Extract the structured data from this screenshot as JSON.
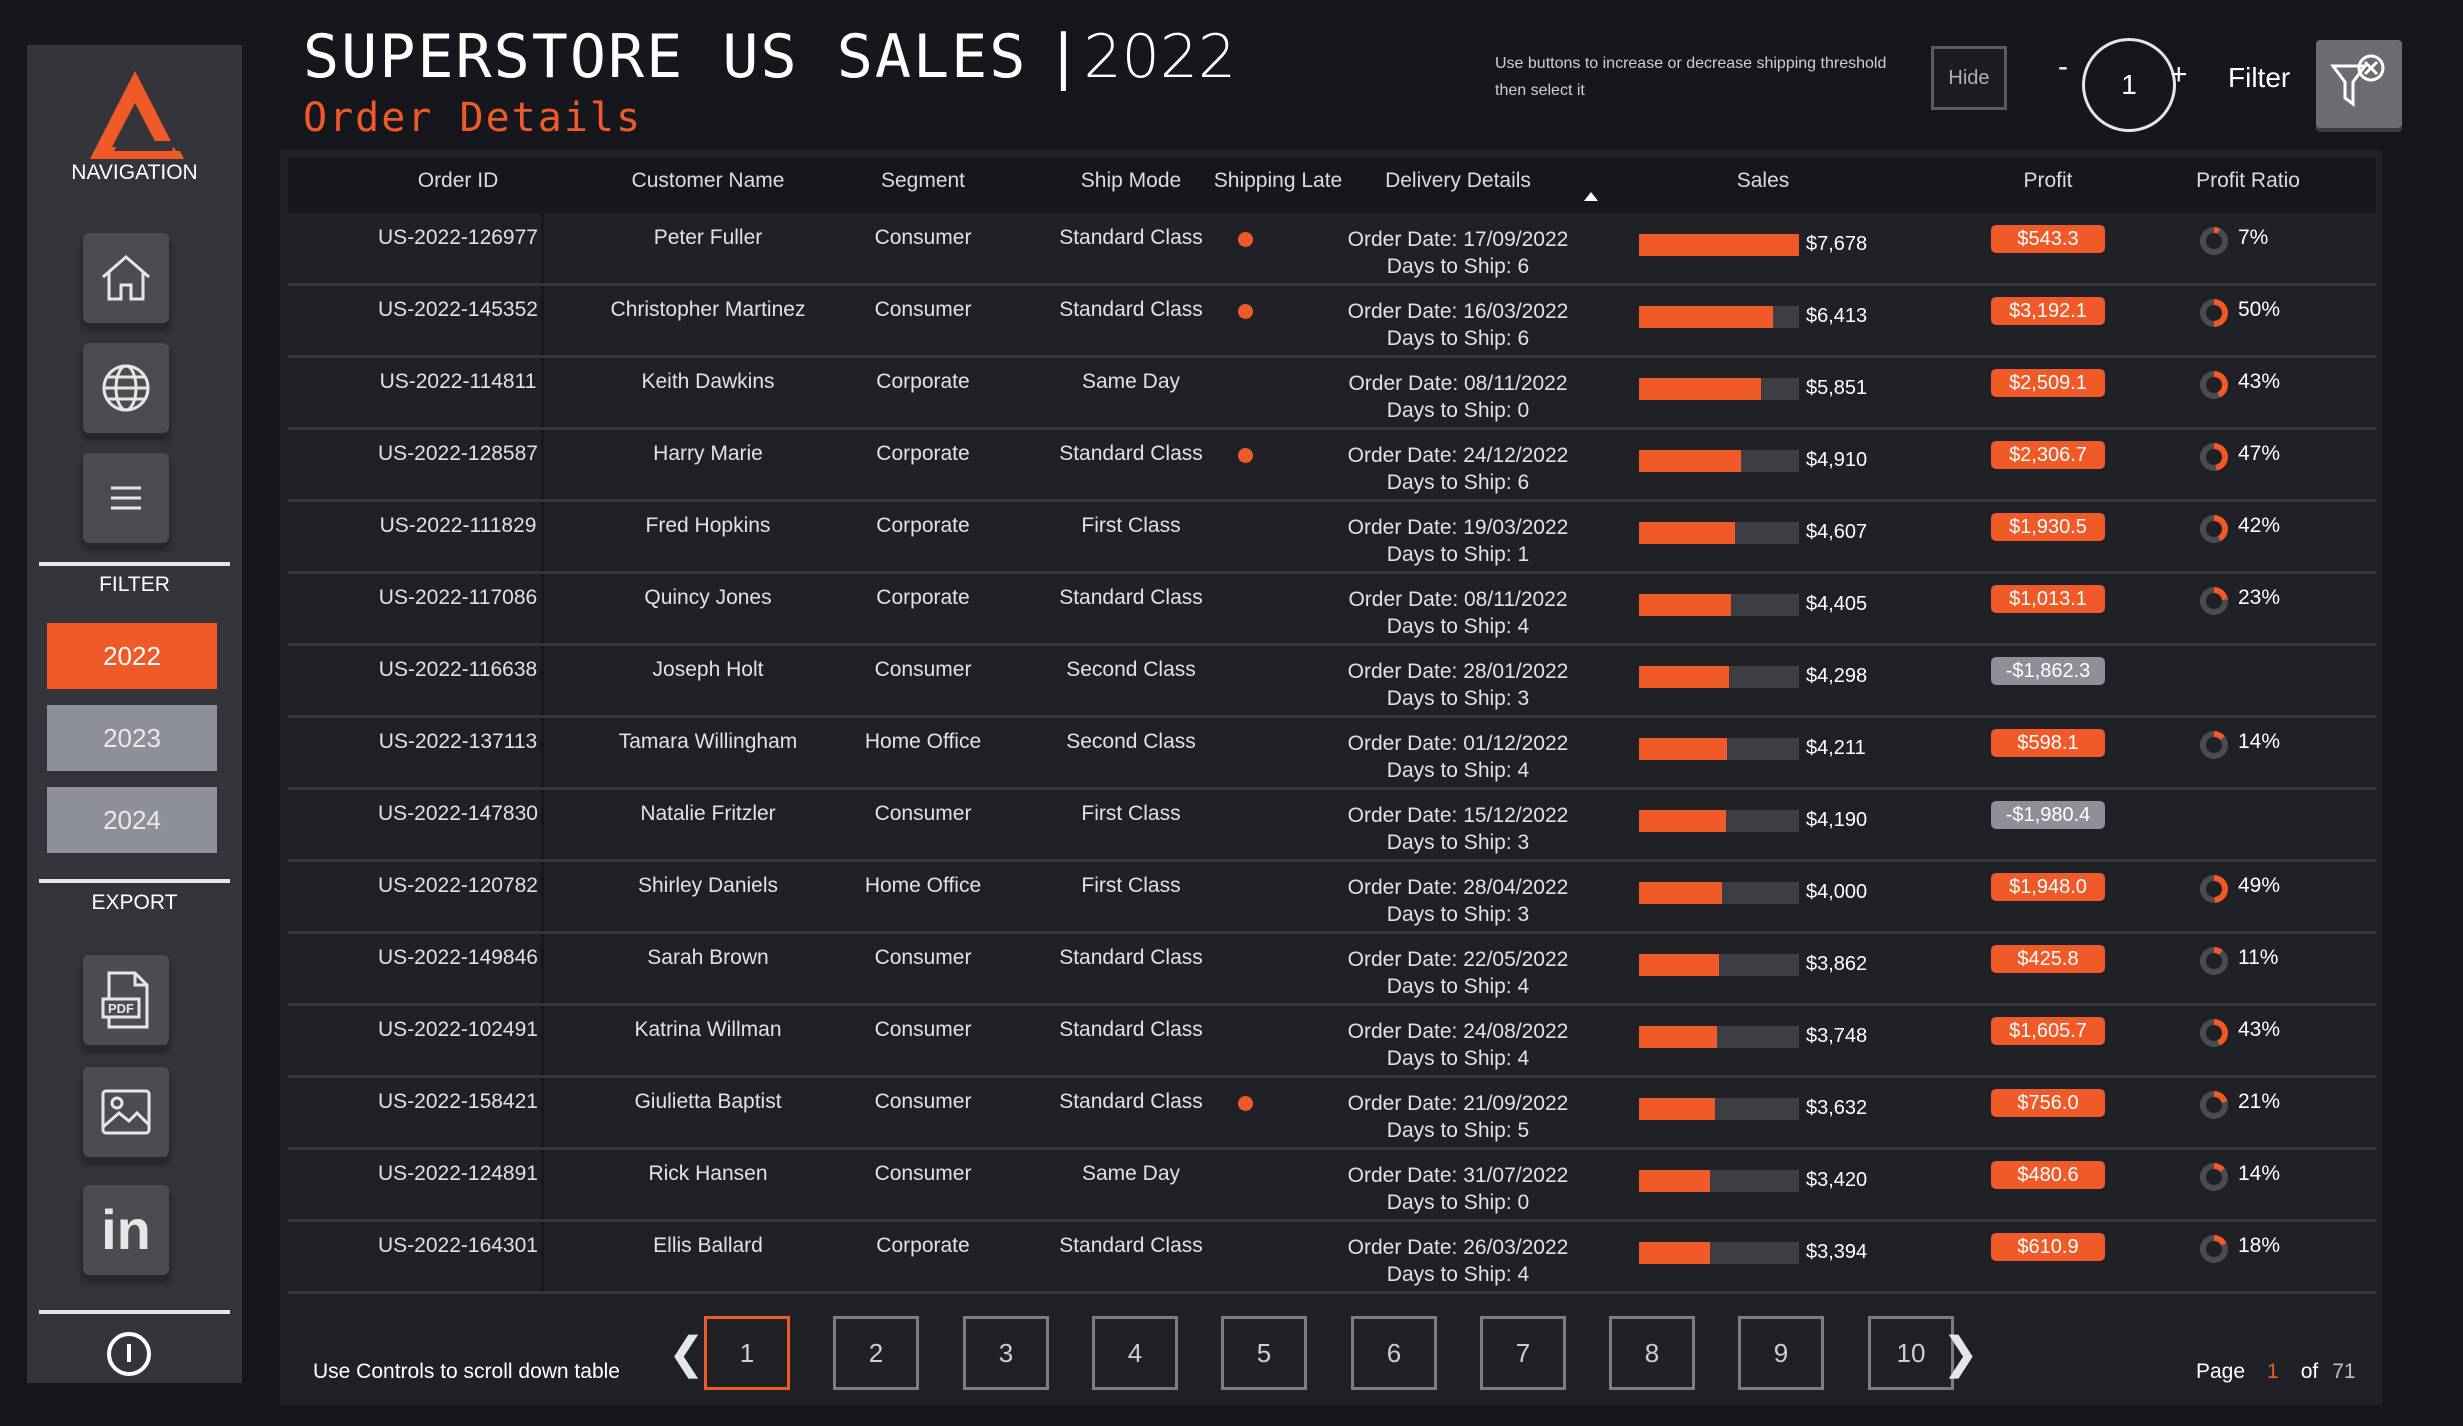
{
  "header": {
    "title": "SUPERSTORE US SALES",
    "separator": "|",
    "year": "2022",
    "subtitle": "Order Details",
    "hint": "Use buttons to increase or decrease shipping threshold then select it",
    "hide_label": "Hide",
    "minus_label": "-",
    "threshold_value": "1",
    "plus_label": "+",
    "filter_label": "Filter"
  },
  "sidebar": {
    "nav_title": "NAVIGATION",
    "filter_title": "FILTER",
    "export_title": "EXPORT",
    "years": [
      "2022",
      "2023",
      "2024"
    ],
    "active_year": "2022",
    "nav_icons": [
      "home-icon",
      "globe-icon",
      "menu-icon"
    ],
    "export_icons": [
      "pdf-icon",
      "image-icon",
      "linkedin-icon"
    ],
    "pdf_label": "PDF",
    "linkedin_label": "in"
  },
  "table": {
    "columns": [
      "Order ID",
      "Customer Name",
      "Segment",
      "Ship Mode",
      "Shipping Late",
      "Delivery Details",
      "Sales",
      "Profit",
      "Profit Ratio"
    ],
    "order_date_prefix": "Order Date: ",
    "days_prefix": "Days to Ship: ",
    "sales_max": 7678,
    "rows": [
      {
        "order_id": "US-2022-126977",
        "customer": "Peter Fuller",
        "segment": "Consumer",
        "ship_mode": "Standard Class",
        "late": true,
        "order_date": "17/09/2022",
        "days": "6",
        "sales": 7678,
        "sales_label": "$7,678",
        "profit": "$543.3",
        "negative": false,
        "ratio": 7,
        "ratio_label": "7%"
      },
      {
        "order_id": "US-2022-145352",
        "customer": "Christopher Martinez",
        "segment": "Consumer",
        "ship_mode": "Standard Class",
        "late": true,
        "order_date": "16/03/2022",
        "days": "6",
        "sales": 6413,
        "sales_label": "$6,413",
        "profit": "$3,192.1",
        "negative": false,
        "ratio": 50,
        "ratio_label": "50%"
      },
      {
        "order_id": "US-2022-114811",
        "customer": "Keith Dawkins",
        "segment": "Corporate",
        "ship_mode": "Same Day",
        "late": false,
        "order_date": "08/11/2022",
        "days": "0",
        "sales": 5851,
        "sales_label": "$5,851",
        "profit": "$2,509.1",
        "negative": false,
        "ratio": 43,
        "ratio_label": "43%"
      },
      {
        "order_id": "US-2022-128587",
        "customer": "Harry Marie",
        "segment": "Corporate",
        "ship_mode": "Standard Class",
        "late": true,
        "order_date": "24/12/2022",
        "days": "6",
        "sales": 4910,
        "sales_label": "$4,910",
        "profit": "$2,306.7",
        "negative": false,
        "ratio": 47,
        "ratio_label": "47%"
      },
      {
        "order_id": "US-2022-111829",
        "customer": "Fred Hopkins",
        "segment": "Corporate",
        "ship_mode": "First Class",
        "late": false,
        "order_date": "19/03/2022",
        "days": "1",
        "sales": 4607,
        "sales_label": "$4,607",
        "profit": "$1,930.5",
        "negative": false,
        "ratio": 42,
        "ratio_label": "42%"
      },
      {
        "order_id": "US-2022-117086",
        "customer": "Quincy Jones",
        "segment": "Corporate",
        "ship_mode": "Standard Class",
        "late": false,
        "order_date": "08/11/2022",
        "days": "4",
        "sales": 4405,
        "sales_label": "$4,405",
        "profit": "$1,013.1",
        "negative": false,
        "ratio": 23,
        "ratio_label": "23%"
      },
      {
        "order_id": "US-2022-116638",
        "customer": "Joseph Holt",
        "segment": "Consumer",
        "ship_mode": "Second Class",
        "late": false,
        "order_date": "28/01/2022",
        "days": "3",
        "sales": 4298,
        "sales_label": "$4,298",
        "profit": "-$1,862.3",
        "negative": true,
        "ratio": null,
        "ratio_label": ""
      },
      {
        "order_id": "US-2022-137113",
        "customer": "Tamara Willingham",
        "segment": "Home Office",
        "ship_mode": "Second Class",
        "late": false,
        "order_date": "01/12/2022",
        "days": "4",
        "sales": 4211,
        "sales_label": "$4,211",
        "profit": "$598.1",
        "negative": false,
        "ratio": 14,
        "ratio_label": "14%"
      },
      {
        "order_id": "US-2022-147830",
        "customer": "Natalie Fritzler",
        "segment": "Consumer",
        "ship_mode": "First Class",
        "late": false,
        "order_date": "15/12/2022",
        "days": "3",
        "sales": 4190,
        "sales_label": "$4,190",
        "profit": "-$1,980.4",
        "negative": true,
        "ratio": null,
        "ratio_label": ""
      },
      {
        "order_id": "US-2022-120782",
        "customer": "Shirley Daniels",
        "segment": "Home Office",
        "ship_mode": "First Class",
        "late": false,
        "order_date": "28/04/2022",
        "days": "3",
        "sales": 4000,
        "sales_label": "$4,000",
        "profit": "$1,948.0",
        "negative": false,
        "ratio": 49,
        "ratio_label": "49%"
      },
      {
        "order_id": "US-2022-149846",
        "customer": "Sarah Brown",
        "segment": "Consumer",
        "ship_mode": "Standard Class",
        "late": false,
        "order_date": "22/05/2022",
        "days": "4",
        "sales": 3862,
        "sales_label": "$3,862",
        "profit": "$425.8",
        "negative": false,
        "ratio": 11,
        "ratio_label": "11%"
      },
      {
        "order_id": "US-2022-102491",
        "customer": "Katrina Willman",
        "segment": "Consumer",
        "ship_mode": "Standard Class",
        "late": false,
        "order_date": "24/08/2022",
        "days": "4",
        "sales": 3748,
        "sales_label": "$3,748",
        "profit": "$1,605.7",
        "negative": false,
        "ratio": 43,
        "ratio_label": "43%"
      },
      {
        "order_id": "US-2022-158421",
        "customer": "Giulietta Baptist",
        "segment": "Consumer",
        "ship_mode": "Standard Class",
        "late": true,
        "order_date": "21/09/2022",
        "days": "5",
        "sales": 3632,
        "sales_label": "$3,632",
        "profit": "$756.0",
        "negative": false,
        "ratio": 21,
        "ratio_label": "21%"
      },
      {
        "order_id": "US-2022-124891",
        "customer": "Rick Hansen",
        "segment": "Consumer",
        "ship_mode": "Same Day",
        "late": false,
        "order_date": "31/07/2022",
        "days": "0",
        "sales": 3420,
        "sales_label": "$3,420",
        "profit": "$480.6",
        "negative": false,
        "ratio": 14,
        "ratio_label": "14%"
      },
      {
        "order_id": "US-2022-164301",
        "customer": "Ellis Ballard",
        "segment": "Corporate",
        "ship_mode": "Standard Class",
        "late": false,
        "order_date": "26/03/2022",
        "days": "4",
        "sales": 3394,
        "sales_label": "$3,394",
        "profit": "$610.9",
        "negative": false,
        "ratio": 18,
        "ratio_label": "18%"
      }
    ]
  },
  "pagination": {
    "hint": "Use Controls to scroll down table",
    "pages": [
      "1",
      "2",
      "3",
      "4",
      "5",
      "6",
      "7",
      "8",
      "9",
      "10"
    ],
    "active_page": "1",
    "prev_label": "❮",
    "next_label": "❯",
    "page_label": "Page",
    "current": "1",
    "of_label": "of",
    "total": "71"
  },
  "colors": {
    "accent": "#f05a28",
    "negative": "#8e9097",
    "background": "#15171c"
  }
}
